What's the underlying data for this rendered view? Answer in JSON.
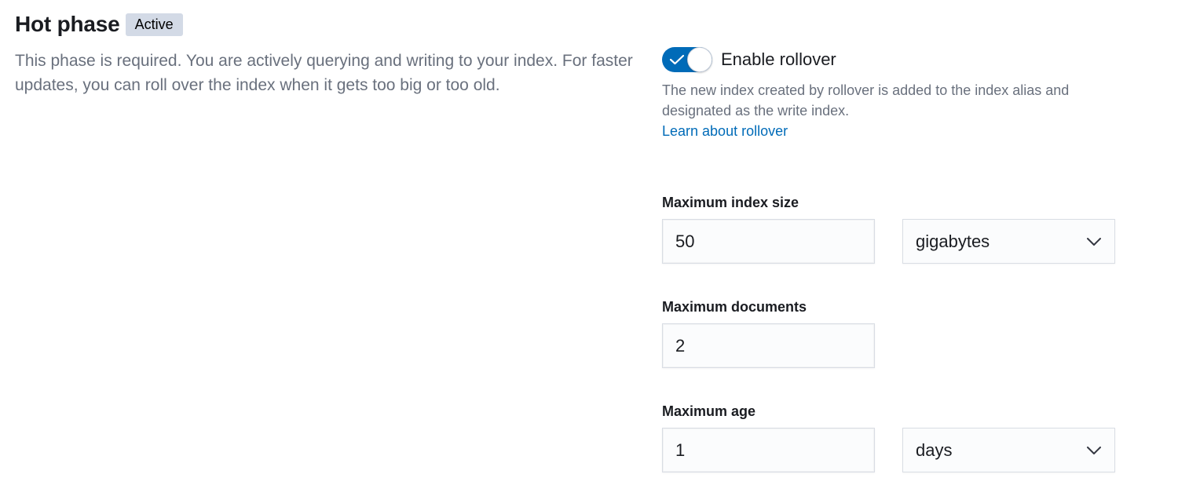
{
  "phase": {
    "title": "Hot phase",
    "badge": "Active",
    "description": "This phase is required. You are actively querying and writing to your index. For faster updates, you can roll over the index when it gets too big or too old."
  },
  "rollover": {
    "enabled": true,
    "switch_label": "Enable rollover",
    "help_text": "The new index created by rollover is added to the index alias and designated as the write index.",
    "learn_link": "Learn about rollover",
    "accent_color": "#006bb8"
  },
  "fields": {
    "max_size": {
      "label": "Maximum index size",
      "value": "50",
      "unit": "gigabytes"
    },
    "max_docs": {
      "label": "Maximum documents",
      "value": "2"
    },
    "max_age": {
      "label": "Maximum age",
      "value": "1",
      "unit": "days"
    }
  }
}
